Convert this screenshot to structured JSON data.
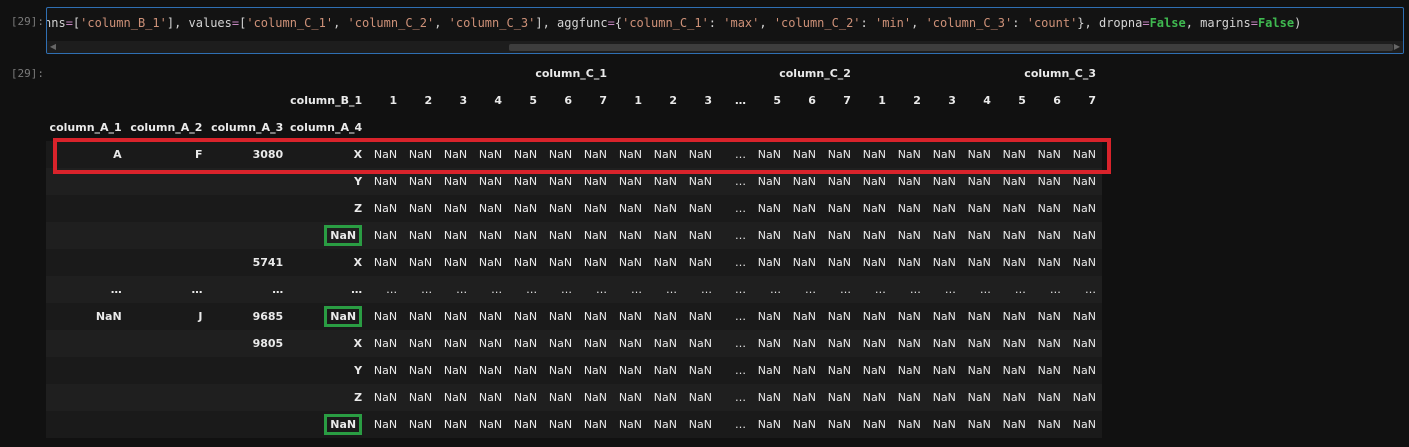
{
  "input_prompt": "[29]:",
  "output_prompt": "[29]:",
  "code": {
    "parts": [
      {
        "t": "nns",
        "c": ""
      },
      {
        "t": "=",
        "c": "op"
      },
      {
        "t": "[",
        "c": ""
      },
      {
        "t": "'column_B_1'",
        "c": "str"
      },
      {
        "t": "], values",
        "c": ""
      },
      {
        "t": "=",
        "c": "op"
      },
      {
        "t": "[",
        "c": ""
      },
      {
        "t": "'column_C_1'",
        "c": "str"
      },
      {
        "t": ", ",
        "c": ""
      },
      {
        "t": "'column_C_2'",
        "c": "str"
      },
      {
        "t": ", ",
        "c": ""
      },
      {
        "t": "'column_C_3'",
        "c": "str"
      },
      {
        "t": "], aggfunc",
        "c": ""
      },
      {
        "t": "=",
        "c": "op"
      },
      {
        "t": "{",
        "c": ""
      },
      {
        "t": "'column_C_1'",
        "c": "str"
      },
      {
        "t": ": ",
        "c": ""
      },
      {
        "t": "'max'",
        "c": "str"
      },
      {
        "t": ", ",
        "c": ""
      },
      {
        "t": "'column_C_2'",
        "c": "str"
      },
      {
        "t": ": ",
        "c": ""
      },
      {
        "t": "'min'",
        "c": "str"
      },
      {
        "t": ", ",
        "c": ""
      },
      {
        "t": "'column_C_3'",
        "c": "str"
      },
      {
        "t": ": ",
        "c": ""
      },
      {
        "t": "'count'",
        "c": "str"
      },
      {
        "t": "}, dropna",
        "c": ""
      },
      {
        "t": "=",
        "c": "op"
      },
      {
        "t": "False",
        "c": "kw"
      },
      {
        "t": ", margins",
        "c": ""
      },
      {
        "t": "=",
        "c": "op"
      },
      {
        "t": "False",
        "c": "kw"
      },
      {
        "t": ")",
        "c": ""
      }
    ]
  },
  "table": {
    "value_groups": [
      {
        "label": "column_C_1",
        "span": 7
      },
      {
        "label": "column_C_2",
        "span": 7
      },
      {
        "label": "column_C_3",
        "span": 7
      }
    ],
    "column_b_label": "column_B_1",
    "sub_columns": [
      "1",
      "2",
      "3",
      "4",
      "5",
      "6",
      "7",
      "1",
      "2",
      "3",
      "…",
      "5",
      "6",
      "7",
      "1",
      "2",
      "3",
      "4",
      "5",
      "6",
      "7"
    ],
    "index_names": [
      "column_A_1",
      "column_A_2",
      "column_A_3",
      "column_A_4"
    ],
    "rows": [
      {
        "idx": [
          "A",
          "F",
          "3080",
          "X"
        ],
        "hl": false
      },
      {
        "idx": [
          "",
          "",
          "",
          "Y"
        ],
        "hl": false
      },
      {
        "idx": [
          "",
          "",
          "",
          "Z"
        ],
        "hl": false
      },
      {
        "idx": [
          "",
          "",
          "",
          "NaN"
        ],
        "hl": true
      },
      {
        "idx": [
          "",
          "",
          "5741",
          "X"
        ],
        "hl": false
      },
      {
        "idx": [
          "…",
          "…",
          "…",
          "…"
        ],
        "hl": false,
        "ellipsis": true
      },
      {
        "idx": [
          "NaN",
          "J",
          "9685",
          "NaN"
        ],
        "hl": true
      },
      {
        "idx": [
          "",
          "",
          "9805",
          "X"
        ],
        "hl": false
      },
      {
        "idx": [
          "",
          "",
          "",
          "Y"
        ],
        "hl": false
      },
      {
        "idx": [
          "",
          "",
          "",
          "Z"
        ],
        "hl": false
      },
      {
        "idx": [
          "",
          "",
          "",
          "NaN"
        ],
        "hl": true
      }
    ],
    "cell_value": "NaN",
    "ellipsis_value": "…"
  }
}
